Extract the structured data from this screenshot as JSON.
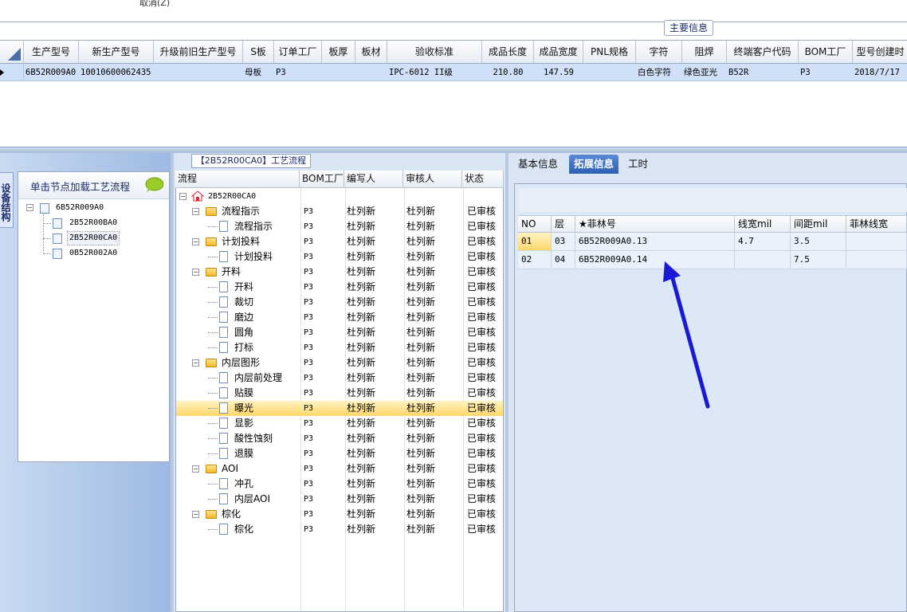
{
  "top": {
    "cancel_label": "取消(Z)",
    "main_info_tab": "主要信息"
  },
  "main_grid": {
    "headers": [
      "生产型号",
      "新生产型号",
      "升级前旧生产型号",
      "S板",
      "订单工厂",
      "板厚",
      "板材",
      "验收标准",
      "成品长度",
      "成品宽度",
      "PNL规格",
      "字符",
      "阻焊",
      "终端客户代码",
      "BOM工厂",
      "型号创建时"
    ],
    "row": [
      "6B52R009A0",
      "10010600062435",
      "",
      "母板",
      "P3",
      "",
      "",
      "IPC-6012 II级",
      "210.80",
      "147.59",
      "",
      "白色字符",
      "绿色亚光",
      "B52R",
      "P3",
      "2018/7/17"
    ]
  },
  "left_panel": {
    "vtab_label": "设备结构",
    "header": "单击节点加载工艺流程",
    "tree": {
      "root": "6B52R009A0",
      "children": [
        "2B52R00BA0",
        "2B52R00CA0",
        "0B52R002A0"
      ]
    }
  },
  "center_panel": {
    "title": "【2B52R00CA0】工艺流程",
    "headers": [
      "流程",
      "BOM工厂",
      "编写人",
      "审核人",
      "状态"
    ],
    "root": "2B52R00CA0",
    "rows": [
      {
        "name": "流程指示",
        "type": "folder",
        "bom": "P3",
        "writer": "杜列新",
        "reviewer": "杜列新",
        "status": "已审核"
      },
      {
        "name": "流程指示",
        "type": "leaf",
        "bom": "P3",
        "writer": "杜列新",
        "reviewer": "杜列新",
        "status": "已审核"
      },
      {
        "name": "计划投料",
        "type": "folder",
        "bom": "P3",
        "writer": "杜列新",
        "reviewer": "杜列新",
        "status": "已审核"
      },
      {
        "name": "计划投料",
        "type": "leaf",
        "bom": "P3",
        "writer": "杜列新",
        "reviewer": "杜列新",
        "status": "已审核"
      },
      {
        "name": "开料",
        "type": "folder",
        "bom": "P3",
        "writer": "杜列新",
        "reviewer": "杜列新",
        "status": "已审核"
      },
      {
        "name": "开料",
        "type": "leaf",
        "bom": "P3",
        "writer": "杜列新",
        "reviewer": "杜列新",
        "status": "已审核"
      },
      {
        "name": "裁切",
        "type": "leaf",
        "bom": "P3",
        "writer": "杜列新",
        "reviewer": "杜列新",
        "status": "已审核"
      },
      {
        "name": "磨边",
        "type": "leaf",
        "bom": "P3",
        "writer": "杜列新",
        "reviewer": "杜列新",
        "status": "已审核"
      },
      {
        "name": "圆角",
        "type": "leaf",
        "bom": "P3",
        "writer": "杜列新",
        "reviewer": "杜列新",
        "status": "已审核"
      },
      {
        "name": "打标",
        "type": "leaf",
        "bom": "P3",
        "writer": "杜列新",
        "reviewer": "杜列新",
        "status": "已审核"
      },
      {
        "name": "内层图形",
        "type": "folder",
        "bom": "P3",
        "writer": "杜列新",
        "reviewer": "杜列新",
        "status": "已审核"
      },
      {
        "name": "内层前处理",
        "type": "leaf",
        "bom": "P3",
        "writer": "杜列新",
        "reviewer": "杜列新",
        "status": "已审核"
      },
      {
        "name": "贴膜",
        "type": "leaf",
        "bom": "P3",
        "writer": "杜列新",
        "reviewer": "杜列新",
        "status": "已审核"
      },
      {
        "name": "曝光",
        "type": "leaf",
        "bom": "P3",
        "writer": "杜列新",
        "reviewer": "杜列新",
        "status": "已审核",
        "selected": true
      },
      {
        "name": "显影",
        "type": "leaf",
        "bom": "P3",
        "writer": "杜列新",
        "reviewer": "杜列新",
        "status": "已审核"
      },
      {
        "name": "酸性蚀刻",
        "type": "leaf",
        "bom": "P3",
        "writer": "杜列新",
        "reviewer": "杜列新",
        "status": "已审核"
      },
      {
        "name": "退膜",
        "type": "leaf",
        "bom": "P3",
        "writer": "杜列新",
        "reviewer": "杜列新",
        "status": "已审核"
      },
      {
        "name": "AOI",
        "type": "folder",
        "bom": "P3",
        "writer": "杜列新",
        "reviewer": "杜列新",
        "status": "已审核"
      },
      {
        "name": "冲孔",
        "type": "leaf",
        "bom": "P3",
        "writer": "杜列新",
        "reviewer": "杜列新",
        "status": "已审核"
      },
      {
        "name": "内层AOI",
        "type": "leaf",
        "bom": "P3",
        "writer": "杜列新",
        "reviewer": "杜列新",
        "status": "已审核"
      },
      {
        "name": "棕化",
        "type": "folder",
        "bom": "P3",
        "writer": "杜列新",
        "reviewer": "杜列新",
        "status": "已审核"
      },
      {
        "name": "棕化",
        "type": "leaf",
        "bom": "P3",
        "writer": "杜列新",
        "reviewer": "杜列新",
        "status": "已审核"
      }
    ]
  },
  "right_panel": {
    "tabs": [
      "基本信息",
      "拓展信息",
      "工时"
    ],
    "active_tab": "拓展信息",
    "headers": [
      "NO",
      "层",
      "★菲林号",
      "线宽mil",
      "间距mil",
      "菲林线宽"
    ],
    "rows": [
      {
        "no": "01",
        "layer": "03",
        "film": "6B52R009A0.13",
        "width": "4.7",
        "spacing": "3.5",
        "film_width": ""
      },
      {
        "no": "02",
        "layer": "04",
        "film": "6B52R009A0.14",
        "width": "",
        "spacing": "7.5",
        "film_width": ""
      }
    ]
  },
  "colors": {
    "accent": "#2d5fb3",
    "selection": "#ffd76a",
    "grid_row": "#cfe0f8",
    "arrow": "#1a1ad6"
  }
}
